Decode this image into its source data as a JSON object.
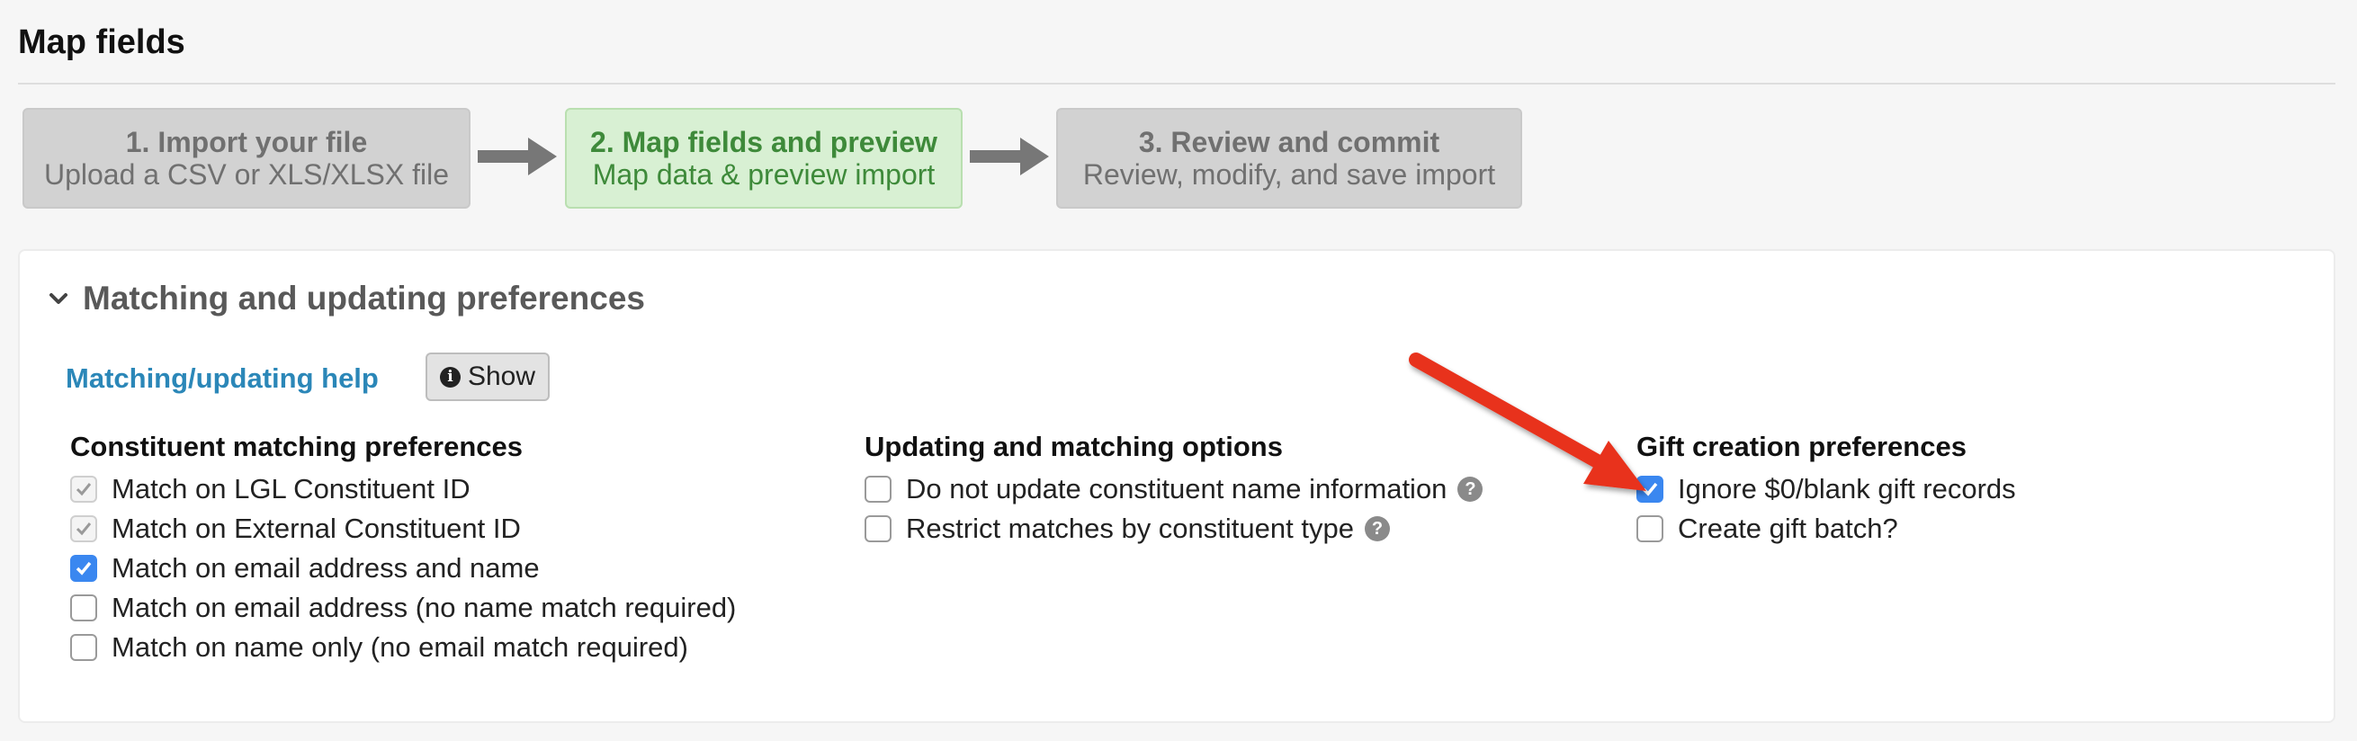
{
  "page": {
    "title": "Map fields"
  },
  "steps": [
    {
      "title": "1. Import your file",
      "subtitle": "Upload a CSV or XLS/XLSX file",
      "state": "inactive"
    },
    {
      "title": "2. Map fields and preview",
      "subtitle": "Map data & preview import",
      "state": "active"
    },
    {
      "title": "3. Review and commit",
      "subtitle": "Review, modify, and save import",
      "state": "inactive"
    }
  ],
  "panel": {
    "title": "Matching and updating preferences",
    "icon": "chevron-down-icon",
    "help_link": "Matching/updating help",
    "show_button": "Show",
    "show_button_icon": "info-circle-icon"
  },
  "columns": {
    "constituent": {
      "heading": "Constituent matching preferences",
      "options": [
        {
          "label": "Match on LGL Constituent ID",
          "checked": true,
          "disabled": true
        },
        {
          "label": "Match on External Constituent ID",
          "checked": true,
          "disabled": true
        },
        {
          "label": "Match on email address and name",
          "checked": true,
          "disabled": false
        },
        {
          "label": "Match on email address (no name match required)",
          "checked": false,
          "disabled": false
        },
        {
          "label": "Match on name only (no email match required)",
          "checked": false,
          "disabled": false
        }
      ]
    },
    "updating": {
      "heading": "Updating and matching options",
      "options": [
        {
          "label": "Do not update constituent name information",
          "checked": false,
          "help_icon": "question-circle-icon"
        },
        {
          "label": "Restrict matches by constituent type",
          "checked": false,
          "help_icon": "question-circle-icon"
        }
      ]
    },
    "gift": {
      "heading": "Gift creation preferences",
      "options": [
        {
          "label": "Ignore $0/blank gift records",
          "checked": true
        },
        {
          "label": "Create gift batch?",
          "checked": false
        }
      ]
    }
  },
  "colors": {
    "accent_blue": "#3a87f0",
    "link_blue": "#2b87b8",
    "active_step_bg": "#d8f0d3",
    "active_step_text": "#3e8a3a",
    "annotation_arrow": "#e8301c"
  }
}
